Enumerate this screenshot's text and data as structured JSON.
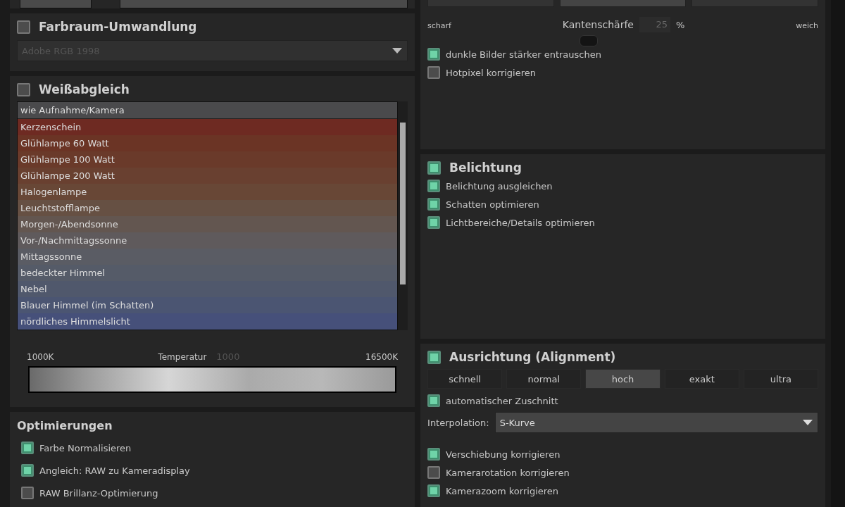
{
  "farbraum": {
    "title": "Farbraum-Umwandlung",
    "checked": false,
    "profile": {
      "value": "Adobe RGB 1998",
      "disabled": true
    }
  },
  "weissabgleich": {
    "title": "Weißabgleich",
    "checked": false,
    "presets": [
      {
        "label": "wie Aufnahme/Kamera",
        "selected": true,
        "color": "#4a4a4c"
      },
      {
        "label": "Kerzenschein",
        "selected": false,
        "color": "#6e2a22"
      },
      {
        "label": "Glühlampe 60 Watt",
        "selected": false,
        "color": "#6b3425"
      },
      {
        "label": "Glühlampe 100 Watt",
        "selected": false,
        "color": "#6a3a2a"
      },
      {
        "label": "Glühlampe 200 Watt",
        "selected": false,
        "color": "#694030"
      },
      {
        "label": "Halogenlampe",
        "selected": false,
        "color": "#684736"
      },
      {
        "label": "Leuchtstofflampe",
        "selected": false,
        "color": "#665043"
      },
      {
        "label": "Morgen-/Abendsonne",
        "selected": false,
        "color": "#635650"
      },
      {
        "label": "Vor-/Nachmittagssonne",
        "selected": false,
        "color": "#5f5a5c"
      },
      {
        "label": "Mittagssonne",
        "selected": false,
        "color": "#5a5c64"
      },
      {
        "label": "bedeckter Himmel",
        "selected": false,
        "color": "#555b68"
      },
      {
        "label": "Nebel",
        "selected": false,
        "color": "#50586c"
      },
      {
        "label": "Blauer Himmel (im Schatten)",
        "selected": false,
        "color": "#4b5572"
      },
      {
        "label": "nördliches Himmelslicht",
        "selected": false,
        "color": "#46507a"
      }
    ],
    "temperature": {
      "min": "1000K",
      "label": "Temperatur",
      "value": "1000",
      "max": "16500K"
    }
  },
  "optimierungen": {
    "title": "Optimierungen",
    "options": [
      {
        "label": "Farbe Normalisieren",
        "checked": true
      },
      {
        "label": "Angleich: RAW zu Kameradisplay",
        "checked": true
      },
      {
        "label": "RAW Brillanz-Optimierung",
        "checked": false
      }
    ]
  },
  "rauschen": {
    "sharpness": {
      "left": "scharf",
      "label": "Kantenschärfe",
      "value": "25",
      "unit": "%",
      "right": "weich"
    },
    "options": [
      {
        "label": "dunkle Bilder stärker entrauschen",
        "checked": true
      },
      {
        "label": "Hotpixel korrigieren",
        "checked": false
      }
    ]
  },
  "belichtung": {
    "title": "Belichtung",
    "checked": true,
    "options": [
      {
        "label": "Belichtung ausgleichen",
        "checked": true
      },
      {
        "label": "Schatten optimieren",
        "checked": true
      },
      {
        "label": "Lichtbereiche/Details optimieren",
        "checked": true
      }
    ]
  },
  "ausrichtung": {
    "title": "Ausrichtung (Alignment)",
    "checked": true,
    "modes": [
      {
        "label": "schnell",
        "selected": false
      },
      {
        "label": "normal",
        "selected": false
      },
      {
        "label": "hoch",
        "selected": true
      },
      {
        "label": "exakt",
        "selected": false
      },
      {
        "label": "ultra",
        "selected": false
      }
    ],
    "autocrop": {
      "label": "automatischer Zuschnitt",
      "checked": true
    },
    "interpolation": {
      "label": "Interpolation:",
      "value": "S-Kurve"
    },
    "options": [
      {
        "label": "Verschiebung korrigieren",
        "checked": true
      },
      {
        "label": "Kamerarotation korrigieren",
        "checked": false
      },
      {
        "label": "Kamerazoom korrigieren",
        "checked": true
      }
    ]
  }
}
